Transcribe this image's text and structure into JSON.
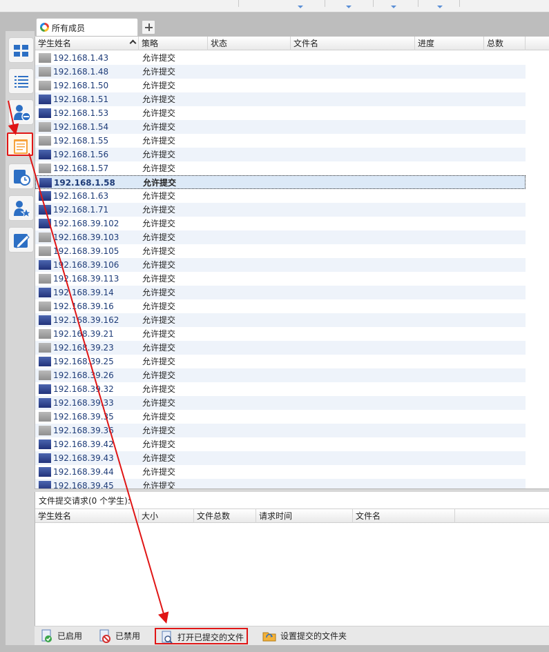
{
  "tab": {
    "label": "所有成员"
  },
  "columns": [
    "学生姓名",
    "策略",
    "状态",
    "文件名",
    "进度",
    "总数"
  ],
  "rows": [
    {
      "ip": "192.168.1.43",
      "policy": "允许提交",
      "online": false
    },
    {
      "ip": "192.168.1.48",
      "policy": "允许提交",
      "online": false
    },
    {
      "ip": "192.168.1.50",
      "policy": "允许提交",
      "online": false
    },
    {
      "ip": "192.168.1.51",
      "policy": "允许提交",
      "online": true
    },
    {
      "ip": "192.168.1.53",
      "policy": "允许提交",
      "online": true
    },
    {
      "ip": "192.168.1.54",
      "policy": "允许提交",
      "online": false
    },
    {
      "ip": "192.168.1.55",
      "policy": "允许提交",
      "online": false
    },
    {
      "ip": "192.168.1.56",
      "policy": "允许提交",
      "online": true
    },
    {
      "ip": "192.168.1.57",
      "policy": "允许提交",
      "online": false
    },
    {
      "ip": "192.168.1.58",
      "policy": "允许提交",
      "online": true,
      "selected": true
    },
    {
      "ip": "192.168.1.63",
      "policy": "允许提交",
      "online": true
    },
    {
      "ip": "192.168.1.71",
      "policy": "允许提交",
      "online": true
    },
    {
      "ip": "192.168.39.102",
      "policy": "允许提交",
      "online": true
    },
    {
      "ip": "192.168.39.103",
      "policy": "允许提交",
      "online": false
    },
    {
      "ip": "192.168.39.105",
      "policy": "允许提交",
      "online": false
    },
    {
      "ip": "192.168.39.106",
      "policy": "允许提交",
      "online": true
    },
    {
      "ip": "192.168.39.113",
      "policy": "允许提交",
      "online": false
    },
    {
      "ip": "192.168.39.14",
      "policy": "允许提交",
      "online": true
    },
    {
      "ip": "192.168.39.16",
      "policy": "允许提交",
      "online": false
    },
    {
      "ip": "192.168.39.162",
      "policy": "允许提交",
      "online": true
    },
    {
      "ip": "192.168.39.21",
      "policy": "允许提交",
      "online": false
    },
    {
      "ip": "192.168.39.23",
      "policy": "允许提交",
      "online": false
    },
    {
      "ip": "192.168.39.25",
      "policy": "允许提交",
      "online": true
    },
    {
      "ip": "192.168.39.26",
      "policy": "允许提交",
      "online": false
    },
    {
      "ip": "192.168.39.32",
      "policy": "允许提交",
      "online": true
    },
    {
      "ip": "192.168.39.33",
      "policy": "允许提交",
      "online": true
    },
    {
      "ip": "192.168.39.35",
      "policy": "允许提交",
      "online": false
    },
    {
      "ip": "192.168.39.36",
      "policy": "允许提交",
      "online": false
    },
    {
      "ip": "192.168.39.42",
      "policy": "允许提交",
      "online": true
    },
    {
      "ip": "192.168.39.43",
      "policy": "允许提交",
      "online": true
    },
    {
      "ip": "192.168.39.44",
      "policy": "允许提交",
      "online": true
    },
    {
      "ip": "192.168.39.45",
      "policy": "允许提交",
      "online": true
    }
  ],
  "request_panel": {
    "title": "文件提交请求(0 个学生):",
    "columns": [
      "学生姓名",
      "大小",
      "文件总数",
      "请求时间",
      "文件名"
    ]
  },
  "bottom_buttons": {
    "enabled": "已启用",
    "disabled": "已禁用",
    "open_files": "打开已提交的文件",
    "set_folder": "设置提交的文件夹"
  },
  "sidebar_icons": [
    "thumbnail-view-icon",
    "list-view-icon",
    "user-remove-icon",
    "file-submission-icon",
    "schedule-icon",
    "user-star-icon",
    "edit-icon"
  ],
  "colors": {
    "annotation": "#e01515",
    "selected_row": "#dce9f7",
    "ip_text": "#1e3c78"
  }
}
